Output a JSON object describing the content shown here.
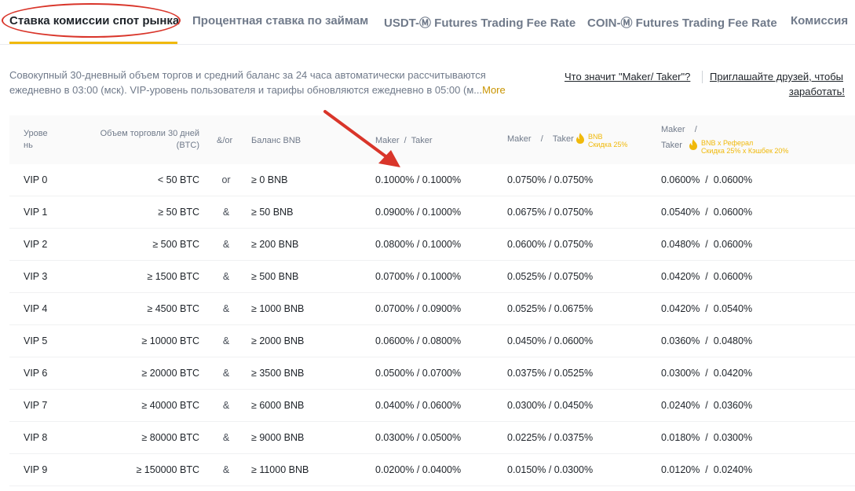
{
  "tabs": [
    {
      "label": "Ставка комиссии спот рынка",
      "active": true
    },
    {
      "label": "Процентная ставка по займам",
      "active": false
    },
    {
      "label": "USDT-Ⓜ Futures Trading Fee Rate",
      "active": false
    },
    {
      "label": "COIN-Ⓜ Futures Trading Fee Rate",
      "active": false
    },
    {
      "label": "Комиссия",
      "active": false
    }
  ],
  "description": {
    "line1": "Совокупный 30-дневный объем торгов и средний баланс за 24 часа автоматически рассчитываются",
    "line2": "ежедневно в 03:00 (мск). VIP-уровень пользователя и тарифы обновляются ежедневно в 05:00 (м...",
    "more": "More"
  },
  "help": {
    "maker_taker_link": "Что значит \"Maker/ Taker\"?",
    "invite_link_1": "Приглашайте друзей, чтобы",
    "invite_link_2": "заработать!"
  },
  "table": {
    "headers": {
      "level_1": "Урове",
      "level_2": "нь",
      "volume_1": "Объем торговли 30 дней",
      "volume_2": "(BTC)",
      "andor": "&/or",
      "bnb_balance": "Баланс BNB",
      "maker_taker": "Maker  /  Taker",
      "maker_taker_bnb": "Maker    /    Taker",
      "bnb_badge_1": "BNB",
      "bnb_badge_2": "Скидка 25%",
      "maker_ref": "Maker    /",
      "taker_ref": "Taker",
      "ref_badge_1": "BNB x Реферал",
      "ref_badge_2": "Скидка 25% x Кэшбек 20%"
    },
    "rows": [
      {
        "level": "VIP 0",
        "volume": "< 50 BTC",
        "op": "or",
        "bnb": "≥ 0 BNB",
        "mt": "0.1000% / 0.1000%",
        "mt_bnb": "0.0750% / 0.0750%",
        "mt_ref": "0.0600%  /  0.0600%"
      },
      {
        "level": "VIP 1",
        "volume": "≥ 50 BTC",
        "op": "&",
        "bnb": "≥ 50 BNB",
        "mt": "0.0900% / 0.1000%",
        "mt_bnb": "0.0675% / 0.0750%",
        "mt_ref": "0.0540%  /  0.0600%"
      },
      {
        "level": "VIP 2",
        "volume": "≥ 500 BTC",
        "op": "&",
        "bnb": "≥ 200 BNB",
        "mt": "0.0800% / 0.1000%",
        "mt_bnb": "0.0600% / 0.0750%",
        "mt_ref": "0.0480%  /  0.0600%"
      },
      {
        "level": "VIP 3",
        "volume": "≥ 1500 BTC",
        "op": "&",
        "bnb": "≥ 500 BNB",
        "mt": "0.0700% / 0.1000%",
        "mt_bnb": "0.0525% / 0.0750%",
        "mt_ref": "0.0420%  /  0.0600%"
      },
      {
        "level": "VIP 4",
        "volume": "≥ 4500 BTC",
        "op": "&",
        "bnb": "≥ 1000 BNB",
        "mt": "0.0700% / 0.0900%",
        "mt_bnb": "0.0525% / 0.0675%",
        "mt_ref": "0.0420%  /  0.0540%"
      },
      {
        "level": "VIP 5",
        "volume": "≥ 10000 BTC",
        "op": "&",
        "bnb": "≥ 2000 BNB",
        "mt": "0.0600% / 0.0800%",
        "mt_bnb": "0.0450% / 0.0600%",
        "mt_ref": "0.0360%  /  0.0480%"
      },
      {
        "level": "VIP 6",
        "volume": "≥ 20000 BTC",
        "op": "&",
        "bnb": "≥ 3500 BNB",
        "mt": "0.0500% / 0.0700%",
        "mt_bnb": "0.0375% / 0.0525%",
        "mt_ref": "0.0300%  /  0.0420%"
      },
      {
        "level": "VIP 7",
        "volume": "≥ 40000 BTC",
        "op": "&",
        "bnb": "≥ 6000 BNB",
        "mt": "0.0400% / 0.0600%",
        "mt_bnb": "0.0300% / 0.0450%",
        "mt_ref": "0.0240%  /  0.0360%"
      },
      {
        "level": "VIP 8",
        "volume": "≥ 80000 BTC",
        "op": "&",
        "bnb": "≥ 9000 BNB",
        "mt": "0.0300% / 0.0500%",
        "mt_bnb": "0.0225% / 0.0375%",
        "mt_ref": "0.0180%  /  0.0300%"
      },
      {
        "level": "VIP 9",
        "volume": "≥ 150000 BTC",
        "op": "&",
        "bnb": "≥ 11000 BNB",
        "mt": "0.0200% / 0.0400%",
        "mt_bnb": "0.0150% / 0.0300%",
        "mt_ref": "0.0120%  /  0.0240%"
      }
    ]
  },
  "colors": {
    "accent": "#f0b90b",
    "more_link": "#c99400",
    "annotation_red": "#d9352a",
    "text_primary": "#1e2329",
    "text_secondary": "#707a8a"
  }
}
